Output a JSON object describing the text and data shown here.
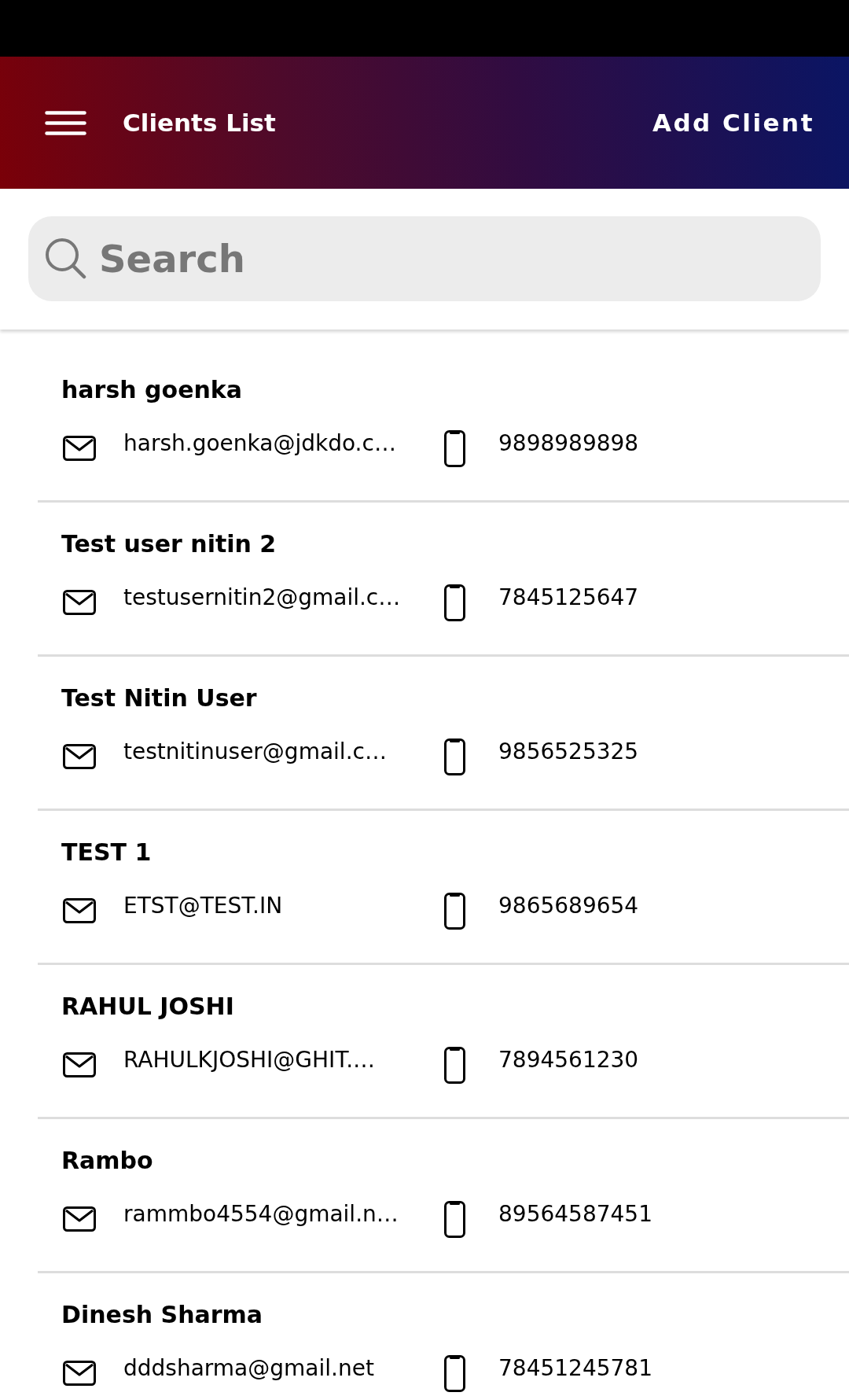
{
  "header": {
    "title": "Clients List",
    "action": "Add Client"
  },
  "search": {
    "placeholder": "Search"
  },
  "clients": [
    {
      "name": "harsh goenka",
      "email": "harsh.goenka@jdkdo.c…",
      "phone": "9898989898"
    },
    {
      "name": "Test user nitin 2",
      "email": "testusernitin2@gmail.c…",
      "phone": "7845125647"
    },
    {
      "name": "Test Nitin User",
      "email": "testnitinuser@gmail.c…",
      "phone": "9856525325"
    },
    {
      "name": "TEST 1",
      "email": "ETST@TEST.IN",
      "phone": "9865689654"
    },
    {
      "name": "RAHUL JOSHI",
      "email": "RAHULKJOSHI@GHIT.…",
      "phone": "7894561230"
    },
    {
      "name": "Rambo",
      "email": "rammbo4554@gmail.n…",
      "phone": "89564587451"
    },
    {
      "name": "Dinesh Sharma",
      "email": "dddsharma@gmail.net",
      "phone": "78451245781"
    }
  ]
}
